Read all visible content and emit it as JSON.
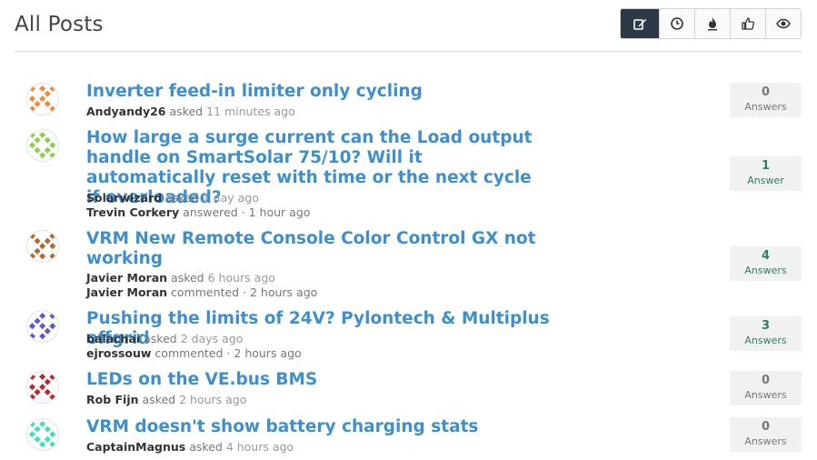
{
  "header": {
    "title": "All Posts"
  },
  "sort_buttons": [
    {
      "icon": "edit-icon",
      "active": true
    },
    {
      "icon": "clock-icon",
      "active": false
    },
    {
      "icon": "flame-icon",
      "active": false
    },
    {
      "icon": "thumbs-up-icon",
      "active": false
    },
    {
      "icon": "eye-icon",
      "active": false
    }
  ],
  "posts": [
    {
      "title": "Inverter feed-in limiter only cycling",
      "asker": "Andyandy26",
      "asked_verb": "asked",
      "asked_time": "11 minutes ago",
      "activity_user": "",
      "activity_verb": "",
      "activity_time": "",
      "answers": "0",
      "answers_label": "Answers",
      "avatar_color": "#f08a3c"
    },
    {
      "title": "How large a surge current can the Load output handle on SmartSolar 75/10? Will it automatically reset with time or the next cycle if overloaded?",
      "asker": "Solarwizard",
      "asked_verb": "asked",
      "asked_time": "1 day ago",
      "activity_user": "Trevin Corkery",
      "activity_verb": "answered",
      "activity_time": "1 hour ago",
      "answers": "1",
      "answers_label": "Answer",
      "avatar_color": "#8ccf4a"
    },
    {
      "title": "VRM New Remote Console Color Control GX not working",
      "asker": "Javier Moran",
      "asked_verb": "asked",
      "asked_time": "6 hours ago",
      "activity_user": "Javier Moran",
      "activity_verb": "commented",
      "activity_time": "2 hours ago",
      "answers": "4",
      "answers_label": "Answers",
      "avatar_color": "#b06a2a"
    },
    {
      "title": "Pushing the limits of 24V? Pylontech & Multiplus offgrid",
      "asker": "balachai",
      "asked_verb": "asked",
      "asked_time": "2 days ago",
      "activity_user": "ejrossouw",
      "activity_verb": "commented",
      "activity_time": "2 hours ago",
      "answers": "3",
      "answers_label": "Answers",
      "avatar_color": "#5a5ad6"
    },
    {
      "title": "LEDs on the VE.bus BMS",
      "asker": "Rob Fijn",
      "asked_verb": "asked",
      "asked_time": "2 hours ago",
      "activity_user": "",
      "activity_verb": "",
      "activity_time": "",
      "answers": "0",
      "answers_label": "Answers",
      "avatar_color": "#c0262e"
    },
    {
      "title": "VRM doesn't show battery charging stats",
      "asker": "CaptainMagnus",
      "asked_verb": "asked",
      "asked_time": "4 hours ago",
      "activity_user": "",
      "activity_verb": "",
      "activity_time": "",
      "answers": "0",
      "answers_label": "Answers",
      "avatar_color": "#3fe0b8"
    }
  ]
}
